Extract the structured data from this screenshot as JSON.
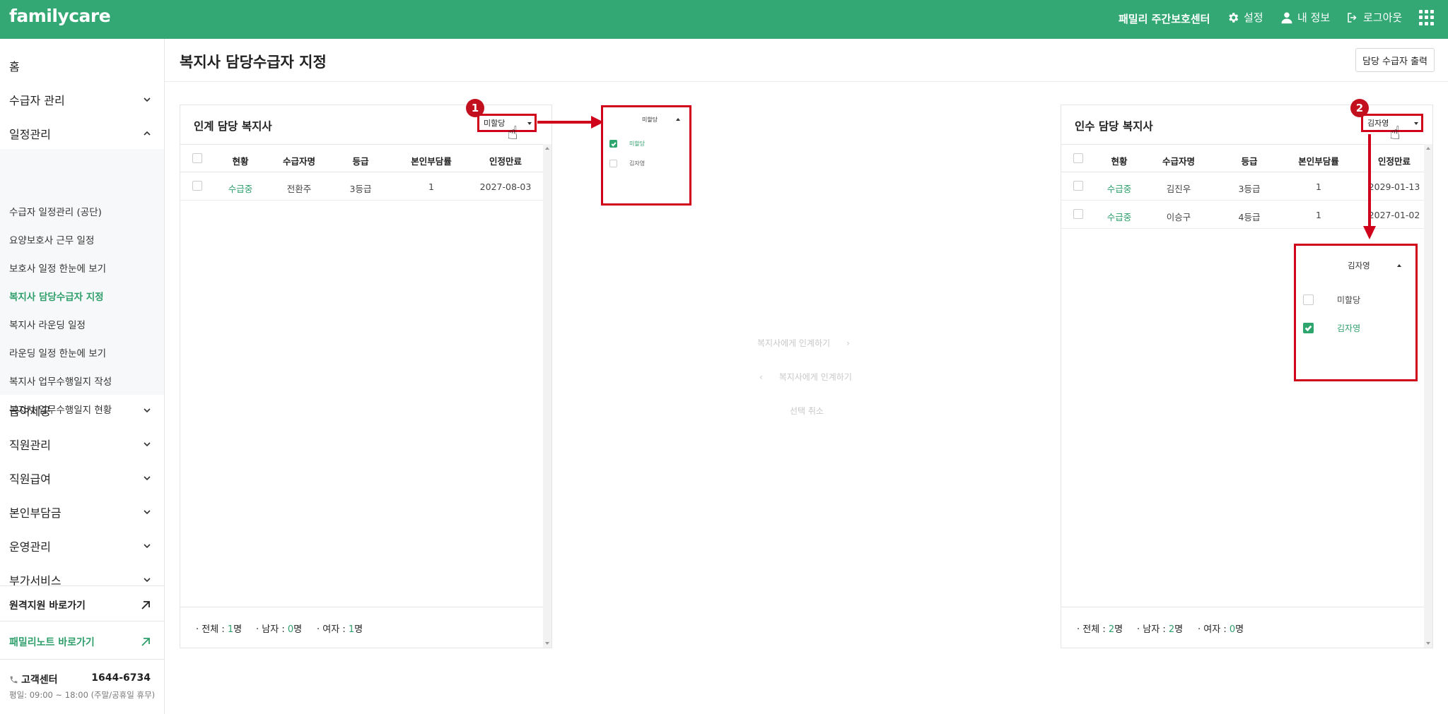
{
  "topbar": {
    "logo": "familycare",
    "center_name": "패밀리 주간보호센터",
    "settings": "설정",
    "my_info": "내 정보",
    "logout": "로그아웃"
  },
  "sidebar": {
    "home": "홈",
    "menu": [
      "수급자 관리",
      "일정관리"
    ],
    "sub_items": [
      "수급자 일정관리 (공단)",
      "요양보호사 근무 일정",
      "보호사 일정 한눈에 보기",
      "복지사 담당수급자 지정",
      "복지사 라운딩 일정",
      "라운딩 일정 한눈에 보기",
      "복지사 업무수행일지 작성",
      "복지사 업무수행일지 현황"
    ],
    "menu2": [
      "급여제공",
      "직원관리",
      "직원급여",
      "본인부담금",
      "운영관리",
      "부가서비스"
    ],
    "remote": "원격지원 바로가기",
    "familynote": "패밀리노트 바로가기",
    "cs_label": "고객센터",
    "cs_phone": "1644-6734",
    "cs_hours": "평일: 09:00 ~ 18:00 (주말/공휴일 휴무)"
  },
  "page": {
    "title": "복지사 담당수급자 지정",
    "print_button": "담당 수급자 출력"
  },
  "columns": [
    "현황",
    "수급자명",
    "등급",
    "본인부담률",
    "인정만료"
  ],
  "left_panel": {
    "title": "인계 담당 복지사",
    "selected": "미할당",
    "rows": [
      {
        "status": "수급중",
        "name": "전환주",
        "grade": "3등급",
        "rate": "1",
        "expiry": "2027-08-03"
      }
    ],
    "footer": {
      "total_label": "전체 : ",
      "total": "1",
      "male_label": "남자 : ",
      "male": "0",
      "female_label": "여자 : ",
      "female": "1",
      "unit": "명"
    }
  },
  "right_panel": {
    "title": "인수 담당 복지사",
    "selected": "김자영",
    "rows": [
      {
        "status": "수급중",
        "name": "김진우",
        "grade": "3등급",
        "rate": "1",
        "expiry": "2029-01-13"
      },
      {
        "status": "수급중",
        "name": "이승구",
        "grade": "4등급",
        "rate": "1",
        "expiry": "2027-01-02"
      }
    ],
    "footer": {
      "total_label": "전체 : ",
      "total": "2",
      "male_label": "남자 : ",
      "male": "2",
      "female_label": "여자 : ",
      "female": "0",
      "unit": "명"
    }
  },
  "center_actions": {
    "to_receiver": "복지사에게 인계하기",
    "to_sender": "복지사에게 인계하기",
    "cancel": "선택 취소"
  },
  "callout_left": {
    "header": "미할당",
    "options": [
      {
        "label": "미할당",
        "checked": true
      },
      {
        "label": "김자영",
        "checked": false
      }
    ]
  },
  "callout_right": {
    "header": "김자영",
    "options": [
      {
        "label": "미할당",
        "checked": false
      },
      {
        "label": "김자영",
        "checked": true
      }
    ]
  },
  "badges": [
    "1",
    "2"
  ],
  "colors": {
    "brand": "#33a874",
    "accent": "#2e9e6b",
    "annotation": "#d0021b"
  }
}
